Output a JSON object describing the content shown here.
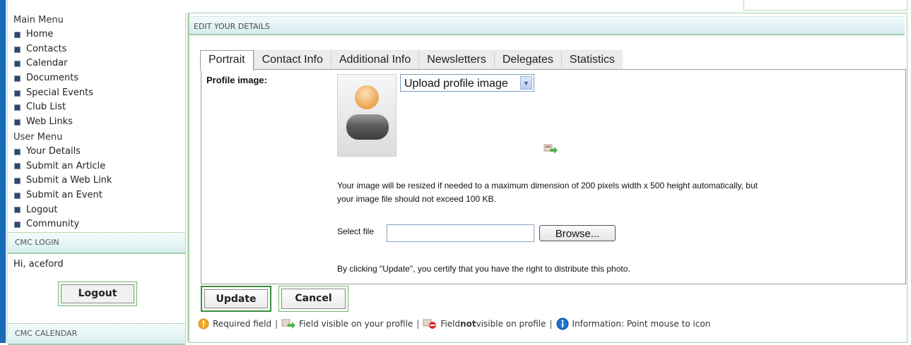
{
  "sidebar": {
    "main_menu_header": "Main Menu",
    "main_items": [
      "Home",
      "Contacts",
      "Calendar",
      "Documents",
      "Special Events",
      "Club List",
      "Web Links"
    ],
    "user_menu_header": "User Menu",
    "user_items": [
      "Your Details",
      "Submit an Article",
      "Submit a Web Link",
      "Submit an Event",
      "Logout",
      "Community"
    ],
    "login_band": "CMC LOGIN",
    "greeting": "Hi, aceford",
    "logout_label": "Logout",
    "calendar_band": "CMC CALENDAR"
  },
  "main": {
    "header": "EDIT YOUR DETAILS",
    "tabs": [
      "Portrait",
      "Contact Info",
      "Additional Info",
      "Newsletters",
      "Delegates",
      "Statistics"
    ],
    "active_tab": "Portrait",
    "profile_label": "Profile image:",
    "select_value": "Upload profile image",
    "info_line1": "Your image will be resized if needed to a maximum dimension of 200 pixels width x 500 height automatically, but",
    "info_line2": "your image file should not exceed 100 KB.",
    "select_file_label": "Select file",
    "file_input_value": "",
    "browse_label": "Browse...",
    "certify_text": "By clicking \"Update\", you certify that you have the right to distribute this photo.",
    "update_label": "Update",
    "cancel_label": "Cancel"
  },
  "legend": {
    "required": "Required field",
    "visible": "Field visible on your profile",
    "not_visible_pre": "Field ",
    "not_visible_bold": "not",
    "not_visible_post": " visible on profile",
    "info_pre": "Information",
    "info_post": ": Point mouse to icon",
    "separator": "|"
  },
  "icons": {
    "bullet": "square-bullet-icon",
    "required": "warning-icon",
    "visible": "visible-field-icon",
    "not_visible": "hidden-field-icon",
    "info": "info-icon"
  },
  "colors": {
    "accent_blue": "#1a6bb5",
    "border_green": "#9fd1a8",
    "band_bg": "#d9eef0"
  }
}
